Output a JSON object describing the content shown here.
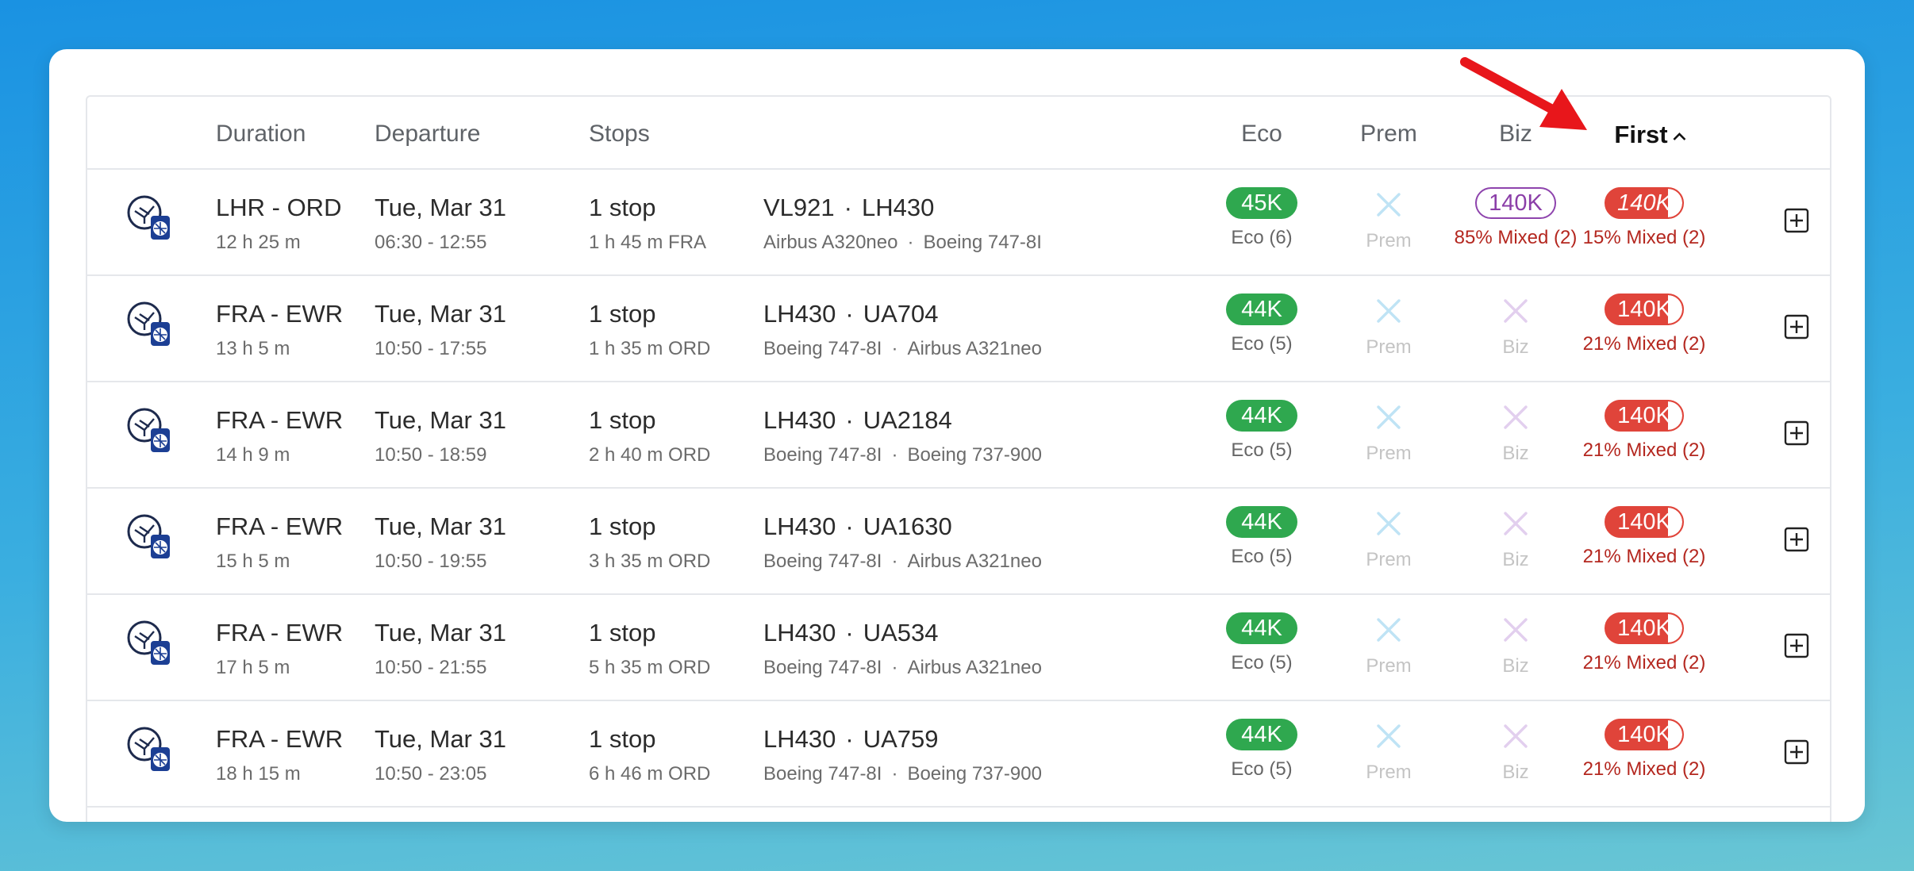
{
  "header": {
    "duration": "Duration",
    "departure": "Departure",
    "stops": "Stops",
    "eco": "Eco",
    "prem": "Prem",
    "biz": "Biz",
    "first": "First"
  },
  "colors": {
    "eco_pill": "#2fa84f",
    "biz_outline": "#8e44ad",
    "first_pill": "#e0443a",
    "mixed_text": "#b4271f",
    "prem_x": "#bfe3f5",
    "biz_x": "#e2cfee",
    "annotation_arrow": "#e8161b"
  },
  "icons": {
    "airline_logo": "lufthansa-united-logo-icon",
    "add": "plus-square-icon",
    "expand": "chevron-down-icon",
    "sort": "chevron-up-icon",
    "unavailable": "x-icon"
  },
  "rows": [
    {
      "route": "LHR - ORD",
      "duration": "12 h 25 m",
      "date": "Tue, Mar 31",
      "times": "06:30 - 12:55",
      "stops": "1 stop",
      "layover": "1 h 45 m FRA",
      "flights": [
        "VL921",
        "LH430"
      ],
      "aircraft": [
        "Airbus A320neo",
        "Boeing 747-8I"
      ],
      "eco": "45K",
      "eco_note": "Eco (6)",
      "prem": "Prem",
      "prem_available": false,
      "biz": "140K",
      "biz_note": "85% Mixed (2)",
      "biz_available": true,
      "first": "140K",
      "first_note": "15% Mixed (2)"
    },
    {
      "route": "FRA - EWR",
      "duration": "13 h 5 m",
      "date": "Tue, Mar 31",
      "times": "10:50 - 17:55",
      "stops": "1 stop",
      "layover": "1 h 35 m ORD",
      "flights": [
        "LH430",
        "UA704"
      ],
      "aircraft": [
        "Boeing 747-8I",
        "Airbus A321neo"
      ],
      "eco": "44K",
      "eco_note": "Eco (5)",
      "prem": "Prem",
      "prem_available": false,
      "biz": "Biz",
      "biz_available": false,
      "first": "140K",
      "first_note": "21% Mixed (2)"
    },
    {
      "route": "FRA - EWR",
      "duration": "14 h 9 m",
      "date": "Tue, Mar 31",
      "times": "10:50 - 18:59",
      "stops": "1 stop",
      "layover": "2 h 40 m ORD",
      "flights": [
        "LH430",
        "UA2184"
      ],
      "aircraft": [
        "Boeing 747-8I",
        "Boeing 737-900"
      ],
      "eco": "44K",
      "eco_note": "Eco (5)",
      "prem": "Prem",
      "prem_available": false,
      "biz": "Biz",
      "biz_available": false,
      "first": "140K",
      "first_note": "21% Mixed (2)"
    },
    {
      "route": "FRA - EWR",
      "duration": "15 h 5 m",
      "date": "Tue, Mar 31",
      "times": "10:50 - 19:55",
      "stops": "1 stop",
      "layover": "3 h 35 m ORD",
      "flights": [
        "LH430",
        "UA1630"
      ],
      "aircraft": [
        "Boeing 747-8I",
        "Airbus A321neo"
      ],
      "eco": "44K",
      "eco_note": "Eco (5)",
      "prem": "Prem",
      "prem_available": false,
      "biz": "Biz",
      "biz_available": false,
      "first": "140K",
      "first_note": "21% Mixed (2)"
    },
    {
      "route": "FRA - EWR",
      "duration": "17 h 5 m",
      "date": "Tue, Mar 31",
      "times": "10:50 - 21:55",
      "stops": "1 stop",
      "layover": "5 h 35 m ORD",
      "flights": [
        "LH430",
        "UA534"
      ],
      "aircraft": [
        "Boeing 747-8I",
        "Airbus A321neo"
      ],
      "eco": "44K",
      "eco_note": "Eco (5)",
      "prem": "Prem",
      "prem_available": false,
      "biz": "Biz",
      "biz_available": false,
      "first": "140K",
      "first_note": "21% Mixed (2)"
    },
    {
      "route": "FRA - EWR",
      "duration": "18 h 15 m",
      "date": "Tue, Mar 31",
      "times": "10:50 - 23:05",
      "stops": "1 stop",
      "layover": "6 h 46 m ORD",
      "flights": [
        "LH430",
        "UA759"
      ],
      "aircraft": [
        "Boeing 747-8I",
        "Boeing 737-900"
      ],
      "eco": "44K",
      "eco_note": "Eco (5)",
      "prem": "Prem",
      "prem_available": false,
      "biz": "Biz",
      "biz_available": false,
      "first": "140K",
      "first_note": "21% Mixed (2)"
    }
  ]
}
